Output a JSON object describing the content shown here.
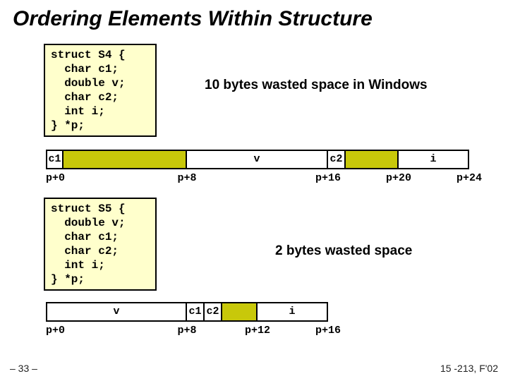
{
  "title": "Ordering Elements Within Structure",
  "code1": "struct S4 {\n  char c1;\n  double v;\n  char c2;\n  int i;\n} *p;",
  "note1": "10 bytes wasted space in Windows",
  "mem1": {
    "c1": "c1",
    "v": "v",
    "c2": "c2",
    "i": "i"
  },
  "off1": {
    "o0": "p+0",
    "o8": "p+8",
    "o16": "p+16",
    "o20": "p+20",
    "o24": "p+24"
  },
  "code2": "struct S5 {\n  double v;\n  char c1;\n  char c2;\n  int i;\n} *p;",
  "note2": "2 bytes wasted space",
  "mem2": {
    "v": "v",
    "c1": "c1",
    "c2": "c2",
    "i": "i"
  },
  "off2": {
    "o0": "p+0",
    "o8": "p+8",
    "o12": "p+12",
    "o16": "p+16"
  },
  "footer_left": "– 33 –",
  "footer_right": "15 -213, F'02",
  "chart_data": [
    {
      "type": "table",
      "title": "struct S4 memory layout (Windows alignment)",
      "total_bytes": 24,
      "wasted_bytes": 10,
      "fields": [
        {
          "name": "c1",
          "offset": 0,
          "size": 1,
          "pad_after": 7
        },
        {
          "name": "v",
          "offset": 8,
          "size": 8,
          "pad_after": 0
        },
        {
          "name": "c2",
          "offset": 16,
          "size": 1,
          "pad_after": 3
        },
        {
          "name": "i",
          "offset": 20,
          "size": 4,
          "pad_after": 0
        }
      ],
      "offset_labels": [
        "p+0",
        "p+8",
        "p+16",
        "p+20",
        "p+24"
      ]
    },
    {
      "type": "table",
      "title": "struct S5 memory layout",
      "total_bytes": 16,
      "wasted_bytes": 2,
      "fields": [
        {
          "name": "v",
          "offset": 0,
          "size": 8,
          "pad_after": 0
        },
        {
          "name": "c1",
          "offset": 8,
          "size": 1,
          "pad_after": 0
        },
        {
          "name": "c2",
          "offset": 9,
          "size": 1,
          "pad_after": 2
        },
        {
          "name": "i",
          "offset": 12,
          "size": 4,
          "pad_after": 0
        }
      ],
      "offset_labels": [
        "p+0",
        "p+8",
        "p+12",
        "p+16"
      ]
    }
  ]
}
